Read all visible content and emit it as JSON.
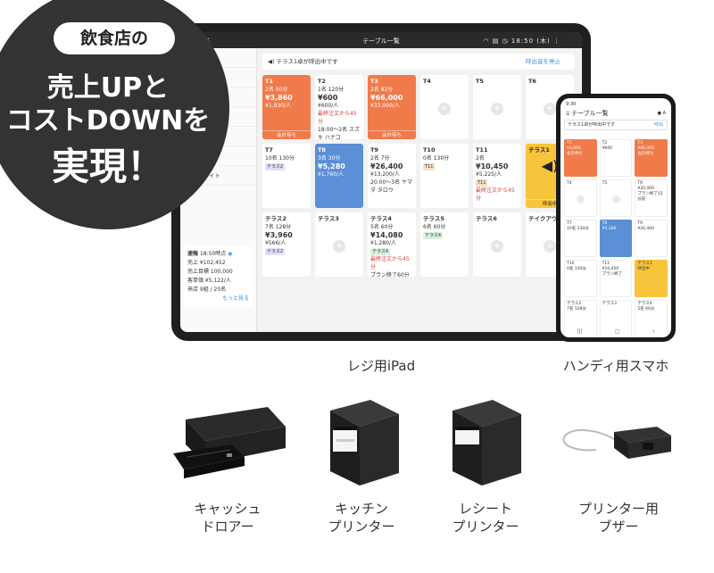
{
  "badge": {
    "pill": "飲食店の",
    "line1": "売上UPと",
    "line2": "コストDOWNを",
    "line3": "実現！"
  },
  "tablet": {
    "back": "戻る",
    "title": "テーブル一覧",
    "time": "18:50 (木)",
    "alert": "テラス1卓が呼出中です",
    "alert_action": "呼出音を停止",
    "menu": [
      "グル一覧",
      "",
      "",
      "発行",
      "ーを開く",
      "設定",
      "ヘルプサイト"
    ],
    "sales": {
      "title": "速報",
      "time": "18:50時点",
      "rows": [
        "売上 ¥102,452",
        "売上目標 100,000",
        "客単価 ¥5,122/人",
        "来店 9組 / 20名"
      ],
      "more": "もっと見る"
    },
    "tables": [
      {
        "name": "T1",
        "style": "orange",
        "line1": "2名 50分",
        "amount": "¥3,860",
        "sub": "¥1,930/人",
        "foot": "会計待ち"
      },
      {
        "name": "T2",
        "style": "white",
        "line1": "1名 120分",
        "amount": "¥600",
        "sub": "¥600/人",
        "note": "最終注文から45分",
        "extra": "18:00〜2名 スズキ ハナコ"
      },
      {
        "name": "T3",
        "style": "orange",
        "line1": "2名 82分",
        "amount": "¥66,000",
        "sub": "¥33,000/人",
        "foot": "会計待ち"
      },
      {
        "name": "T4",
        "style": "empty"
      },
      {
        "name": "T5",
        "style": "empty"
      },
      {
        "name": "T6",
        "style": "empty"
      },
      {
        "name": "T7",
        "style": "white",
        "line1": "10名 130分",
        "tag": "テラス2",
        "tagc": "purple"
      },
      {
        "name": "T8",
        "style": "blue",
        "line1": "3名 30分",
        "amount": "¥5,280",
        "sub": "¥1,760/人"
      },
      {
        "name": "T9",
        "style": "white",
        "line1": "2名 7分",
        "amount": "¥26,400",
        "sub": "¥13,200/人",
        "extra": "20:00〜3名 ヤマダ タロウ"
      },
      {
        "name": "T10",
        "style": "white",
        "line1": "0名 130分",
        "tag": "T11",
        "tagc": "tan"
      },
      {
        "name": "T11",
        "style": "white",
        "line1": "2名",
        "amount": "¥10,450",
        "sub": "¥5,225/人",
        "tag": "T11",
        "tagc": "tan",
        "note": "最終注文から45分"
      },
      {
        "name": "テラス1",
        "style": "yellow",
        "foot": "呼出中"
      },
      {
        "name": "テラス2",
        "style": "white",
        "line1": "7名 128分",
        "amount": "¥3,960",
        "sub": "¥566/人",
        "tag": "テラス2",
        "tagc": "purple"
      },
      {
        "name": "テラス3",
        "style": "empty"
      },
      {
        "name": "テラス4",
        "style": "white",
        "line1": "5名 60分",
        "amount": "¥14,080",
        "sub": "¥1,280/人",
        "tag": "テラス4",
        "tagc": "green",
        "note": "最終注文から45分",
        "extra": "プラン終了60分前"
      },
      {
        "name": "テラス5",
        "style": "white",
        "line1": "6名 60分",
        "tag": "テラス4",
        "tagc": "green"
      },
      {
        "name": "テラス6",
        "style": "empty"
      },
      {
        "name": "テイクアウ",
        "style": "empty"
      }
    ]
  },
  "phone": {
    "clock": "9:30",
    "title": "テーブル一覧",
    "alert": "テラス1卓が呼出中です",
    "alert_action": "呼出",
    "tables": [
      {
        "name": "T1",
        "style": "orange",
        "v": "¥3,860",
        "f": "会計待ち"
      },
      {
        "name": "T2",
        "style": "white",
        "v": "¥600",
        "f": ""
      },
      {
        "name": "T3",
        "style": "orange",
        "v": "¥66,000",
        "f": "会計待ち"
      },
      {
        "name": "T4",
        "style": "empty",
        "v": "",
        "f": ""
      },
      {
        "name": "T5",
        "style": "empty",
        "v": "",
        "f": ""
      },
      {
        "name": "T6",
        "style": "white",
        "v": "¥20,000",
        "f": "プラン終了15分前"
      },
      {
        "name": "T7",
        "style": "white",
        "v": "10名 130分",
        "f": ""
      },
      {
        "name": "T8",
        "style": "blue",
        "v": "¥5,280",
        "f": ""
      },
      {
        "name": "T9",
        "style": "white",
        "v": "¥26,400",
        "f": ""
      },
      {
        "name": "T10",
        "style": "white",
        "v": "0名 130分",
        "f": ""
      },
      {
        "name": "T11",
        "style": "white",
        "v": "¥10,450",
        "f": "プラン終了"
      },
      {
        "name": "テラス1",
        "style": "yellow",
        "v": "",
        "f": "呼出中"
      },
      {
        "name": "テラス2",
        "style": "white",
        "v": "7名 128分",
        "f": ""
      },
      {
        "name": "テラス3",
        "style": "white",
        "v": "",
        "f": ""
      },
      {
        "name": "テラス4",
        "style": "white",
        "v": "5名 60分",
        "f": ""
      }
    ]
  },
  "captions": {
    "ipad": "レジ用iPad",
    "smartphone": "ハンディ用スマホ",
    "drawer": [
      "キャッシュ",
      "ドロアー"
    ],
    "kitchen": [
      "キッチン",
      "プリンター"
    ],
    "receipt": [
      "レシート",
      "プリンター"
    ],
    "buzzer": [
      "プリンター用",
      "ブザー"
    ]
  }
}
